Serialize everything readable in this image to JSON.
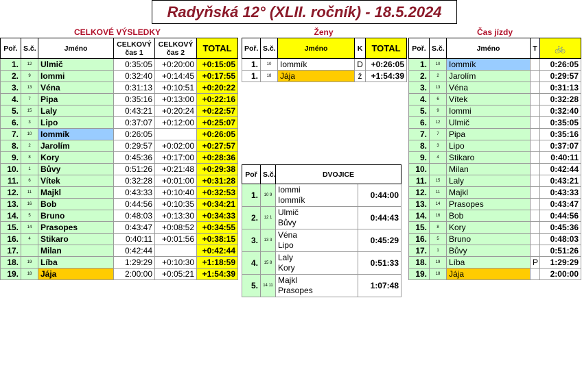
{
  "title": "Radyňská 12° (XLII. ročník) - 18.5.2024",
  "sections": {
    "overall": "CELKOVÉ VÝSLEDKY",
    "women": "Ženy",
    "ride": "Čas jízdy"
  },
  "overall": {
    "headers": {
      "rank": "Poř.",
      "sc": "S.č.",
      "name": "Jméno",
      "t1": "CELKOVÝ čas 1",
      "t2": "CELKOVÝ čas 2",
      "total": "TOTAL"
    },
    "rows": [
      {
        "rank": "1.",
        "sc": "12",
        "name": "Ulmič",
        "t1": "0:35:05",
        "t2": "+0:20:00",
        "total": "+0:15:05",
        "hl": ""
      },
      {
        "rank": "2.",
        "sc": "9",
        "name": "Iommi",
        "t1": "0:32:40",
        "t2": "+0:14:45",
        "total": "+0:17:55",
        "hl": ""
      },
      {
        "rank": "3.",
        "sc": "13",
        "name": "Véna",
        "t1": "0:31:13",
        "t2": "+0:10:51",
        "total": "+0:20:22",
        "hl": ""
      },
      {
        "rank": "4.",
        "sc": "7",
        "name": "Pipa",
        "t1": "0:35:16",
        "t2": "+0:13:00",
        "total": "+0:22:16",
        "hl": ""
      },
      {
        "rank": "5.",
        "sc": "15",
        "name": "Laly",
        "t1": "0:43:21",
        "t2": "+0:20:24",
        "total": "+0:22:57",
        "hl": ""
      },
      {
        "rank": "6.",
        "sc": "3",
        "name": "Lipo",
        "t1": "0:37:07",
        "t2": "+0:12:00",
        "total": "+0:25:07",
        "hl": ""
      },
      {
        "rank": "7.",
        "sc": "10",
        "name": "Iommík",
        "t1": "0:26:05",
        "t2": "",
        "total": "+0:26:05",
        "hl": "sel"
      },
      {
        "rank": "8.",
        "sc": "2",
        "name": "Jarolím",
        "t1": "0:29:57",
        "t2": "+0:02:00",
        "total": "+0:27:57",
        "hl": ""
      },
      {
        "rank": "9.",
        "sc": "8",
        "name": "Kory",
        "t1": "0:45:36",
        "t2": "+0:17:00",
        "total": "+0:28:36",
        "hl": ""
      },
      {
        "rank": "10.",
        "sc": "1",
        "name": "Bůvy",
        "t1": "0:51:26",
        "t2": "+0:21:48",
        "total": "+0:29:38",
        "hl": ""
      },
      {
        "rank": "11.",
        "sc": "6",
        "name": "Vítek",
        "t1": "0:32:28",
        "t2": "+0:01:00",
        "total": "+0:31:28",
        "hl": ""
      },
      {
        "rank": "12.",
        "sc": "11",
        "name": "Majkl",
        "t1": "0:43:33",
        "t2": "+0:10:40",
        "total": "+0:32:53",
        "hl": ""
      },
      {
        "rank": "13.",
        "sc": "16",
        "name": "Bob",
        "t1": "0:44:56",
        "t2": "+0:10:35",
        "total": "+0:34:21",
        "hl": ""
      },
      {
        "rank": "14.",
        "sc": "5",
        "name": "Bruno",
        "t1": "0:48:03",
        "t2": "+0:13:30",
        "total": "+0:34:33",
        "hl": ""
      },
      {
        "rank": "15.",
        "sc": "14",
        "name": "Prasopes",
        "t1": "0:43:47",
        "t2": "+0:08:52",
        "total": "+0:34:55",
        "hl": ""
      },
      {
        "rank": "16.",
        "sc": "4",
        "name": "Stikaro",
        "t1": "0:40:11",
        "t2": "+0:01:56",
        "total": "+0:38:15",
        "hl": ""
      },
      {
        "rank": "17.",
        "sc": "",
        "name": "Milan",
        "t1": "0:42:44",
        "t2": "",
        "total": "+0:42:44",
        "hl": ""
      },
      {
        "rank": "18.",
        "sc": "19",
        "name": "Líba",
        "t1": "1:29:29",
        "t2": "+0:10:30",
        "total": "+1:18:59",
        "hl": ""
      },
      {
        "rank": "19.",
        "sc": "18",
        "name": "Jája",
        "t1": "2:00:00",
        "t2": "+0:05:21",
        "total": "+1:54:39",
        "hl": "ora"
      }
    ]
  },
  "women": {
    "headers": {
      "rank": "Poř.",
      "sc": "S.č.",
      "name": "Jméno",
      "k": "K",
      "total": "TOTAL"
    },
    "rows": [
      {
        "rank": "1.",
        "sc": "10",
        "name": "Iommík",
        "k": "D",
        "total": "+0:26:05",
        "hl": ""
      },
      {
        "rank": "1.",
        "sc": "18",
        "name": "Jája",
        "k": "ž",
        "total": "+1:54:39",
        "hl": "ora"
      }
    ]
  },
  "pairs": {
    "headers": {
      "rank": "Poř",
      "sc": "S.č.",
      "title": "DVOJICE"
    },
    "rows": [
      {
        "rank": "1.",
        "sc": "10 9",
        "a": "Iommi",
        "b": "Iommík",
        "time": "0:44:00"
      },
      {
        "rank": "2.",
        "sc": "12 1",
        "a": "Ulmič",
        "b": "Bůvy",
        "time": "0:44:43"
      },
      {
        "rank": "3.",
        "sc": "13 3",
        "a": "Véna",
        "b": "Lipo",
        "time": "0:45:29"
      },
      {
        "rank": "4.",
        "sc": "15 8",
        "a": "Laly",
        "b": "Kory",
        "time": "0:51:33"
      },
      {
        "rank": "5.",
        "sc": "14 11",
        "a": "Majkl",
        "b": "Prasopes",
        "time": "1:07:48"
      }
    ]
  },
  "ride": {
    "headers": {
      "rank": "Poř.",
      "sc": "S.č.",
      "name": "Jméno",
      "t": "T",
      "bike": "🚲"
    },
    "rows": [
      {
        "rank": "1.",
        "sc": "10",
        "name": "Iommík",
        "t": "",
        "time": "0:26:05",
        "hl": "sel"
      },
      {
        "rank": "2.",
        "sc": "2",
        "name": "Jarolím",
        "t": "",
        "time": "0:29:57",
        "hl": ""
      },
      {
        "rank": "3.",
        "sc": "13",
        "name": "Véna",
        "t": "",
        "time": "0:31:13",
        "hl": ""
      },
      {
        "rank": "4.",
        "sc": "6",
        "name": "Vítek",
        "t": "",
        "time": "0:32:28",
        "hl": ""
      },
      {
        "rank": "5.",
        "sc": "9",
        "name": "Iommi",
        "t": "",
        "time": "0:32:40",
        "hl": ""
      },
      {
        "rank": "6.",
        "sc": "12",
        "name": "Ulmič",
        "t": "",
        "time": "0:35:05",
        "hl": ""
      },
      {
        "rank": "7.",
        "sc": "7",
        "name": "Pipa",
        "t": "",
        "time": "0:35:16",
        "hl": ""
      },
      {
        "rank": "8.",
        "sc": "3",
        "name": "Lipo",
        "t": "",
        "time": "0:37:07",
        "hl": ""
      },
      {
        "rank": "9.",
        "sc": "4",
        "name": "Stikaro",
        "t": "",
        "time": "0:40:11",
        "hl": ""
      },
      {
        "rank": "10.",
        "sc": "",
        "name": "Milan",
        "t": "",
        "time": "0:42:44",
        "hl": ""
      },
      {
        "rank": "11.",
        "sc": "15",
        "name": "Laly",
        "t": "",
        "time": "0:43:21",
        "hl": ""
      },
      {
        "rank": "12.",
        "sc": "11",
        "name": "Majkl",
        "t": "",
        "time": "0:43:33",
        "hl": ""
      },
      {
        "rank": "13.",
        "sc": "14",
        "name": "Prasopes",
        "t": "",
        "time": "0:43:47",
        "hl": ""
      },
      {
        "rank": "14.",
        "sc": "16",
        "name": "Bob",
        "t": "",
        "time": "0:44:56",
        "hl": ""
      },
      {
        "rank": "15.",
        "sc": "8",
        "name": "Kory",
        "t": "",
        "time": "0:45:36",
        "hl": ""
      },
      {
        "rank": "16.",
        "sc": "5",
        "name": "Bruno",
        "t": "",
        "time": "0:48:03",
        "hl": ""
      },
      {
        "rank": "17.",
        "sc": "1",
        "name": "Bůvy",
        "t": "",
        "time": "0:51:26",
        "hl": ""
      },
      {
        "rank": "18.",
        "sc": "19",
        "name": "Líba",
        "t": "P",
        "time": "1:29:29",
        "hl": ""
      },
      {
        "rank": "19.",
        "sc": "18",
        "name": "Jája",
        "t": "",
        "time": "2:00:00",
        "hl": "ora"
      }
    ]
  }
}
